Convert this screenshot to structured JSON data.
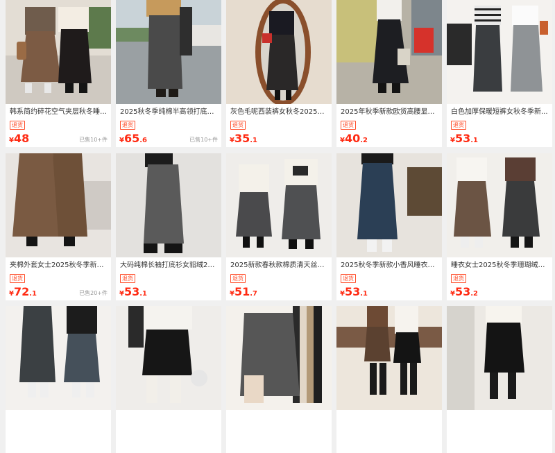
{
  "products": [
    {
      "title": "韩系简约碎花空气夹层秋冬睡衣...",
      "badge": "退货",
      "currency": "¥",
      "price_int": "48",
      "price_dec": "",
      "sold": "已售10+件"
    },
    {
      "title": "2025秋冬季纯棉半高领打底衫...",
      "badge": "退货",
      "currency": "¥",
      "price_int": "65",
      "price_dec": ".6",
      "sold": "已售10+件"
    },
    {
      "title": "灰色毛呢西装裤女秋冬2025新...",
      "badge": "退货",
      "currency": "¥",
      "price_int": "35",
      "price_dec": ".1",
      "sold": ""
    },
    {
      "title": "2025年秋季新款欧货高腰显瘦...",
      "badge": "退货",
      "currency": "¥",
      "price_int": "40",
      "price_dec": ".2",
      "sold": ""
    },
    {
      "title": "白色加厚保暖短裤女秋冬季新...",
      "badge": "退货",
      "currency": "¥",
      "price_int": "53",
      "price_dec": ".1",
      "sold": ""
    },
    {
      "title": "夹棉外套女士2025秋冬季新款...",
      "badge": "退货",
      "currency": "¥",
      "price_int": "72",
      "price_dec": ".1",
      "sold": "已售20+件"
    },
    {
      "title": "大码纯棉长袖打底衫女貂绒202...",
      "badge": "退货",
      "currency": "¥",
      "price_int": "53",
      "price_dec": ".1",
      "sold": ""
    },
    {
      "title": "2025新款春秋款棉质清天丝波...",
      "badge": "退货",
      "currency": "¥",
      "price_int": "51",
      "price_dec": ".7",
      "sold": ""
    },
    {
      "title": "2025秋冬季新款小香风睡衣女...",
      "badge": "退货",
      "currency": "¥",
      "price_int": "53",
      "price_dec": ".1",
      "sold": ""
    },
    {
      "title": "睡衣女士2025秋冬季珊瑚绒拉...",
      "badge": "退货",
      "currency": "¥",
      "price_int": "53",
      "price_dec": ".2",
      "sold": ""
    },
    {
      "title": "",
      "badge": "",
      "currency": "",
      "price_int": "",
      "price_dec": "",
      "sold": ""
    },
    {
      "title": "",
      "badge": "",
      "currency": "",
      "price_int": "",
      "price_dec": "",
      "sold": ""
    },
    {
      "title": "",
      "badge": "",
      "currency": "",
      "price_int": "",
      "price_dec": "",
      "sold": ""
    },
    {
      "title": "",
      "badge": "",
      "currency": "",
      "price_int": "",
      "price_dec": "",
      "sold": ""
    },
    {
      "title": "",
      "badge": "",
      "currency": "",
      "price_int": "",
      "price_dec": "",
      "sold": ""
    }
  ],
  "colors": {
    "price": "#ff2a12",
    "badge": "#ff4e2b",
    "bg": "#f0f0f0"
  }
}
